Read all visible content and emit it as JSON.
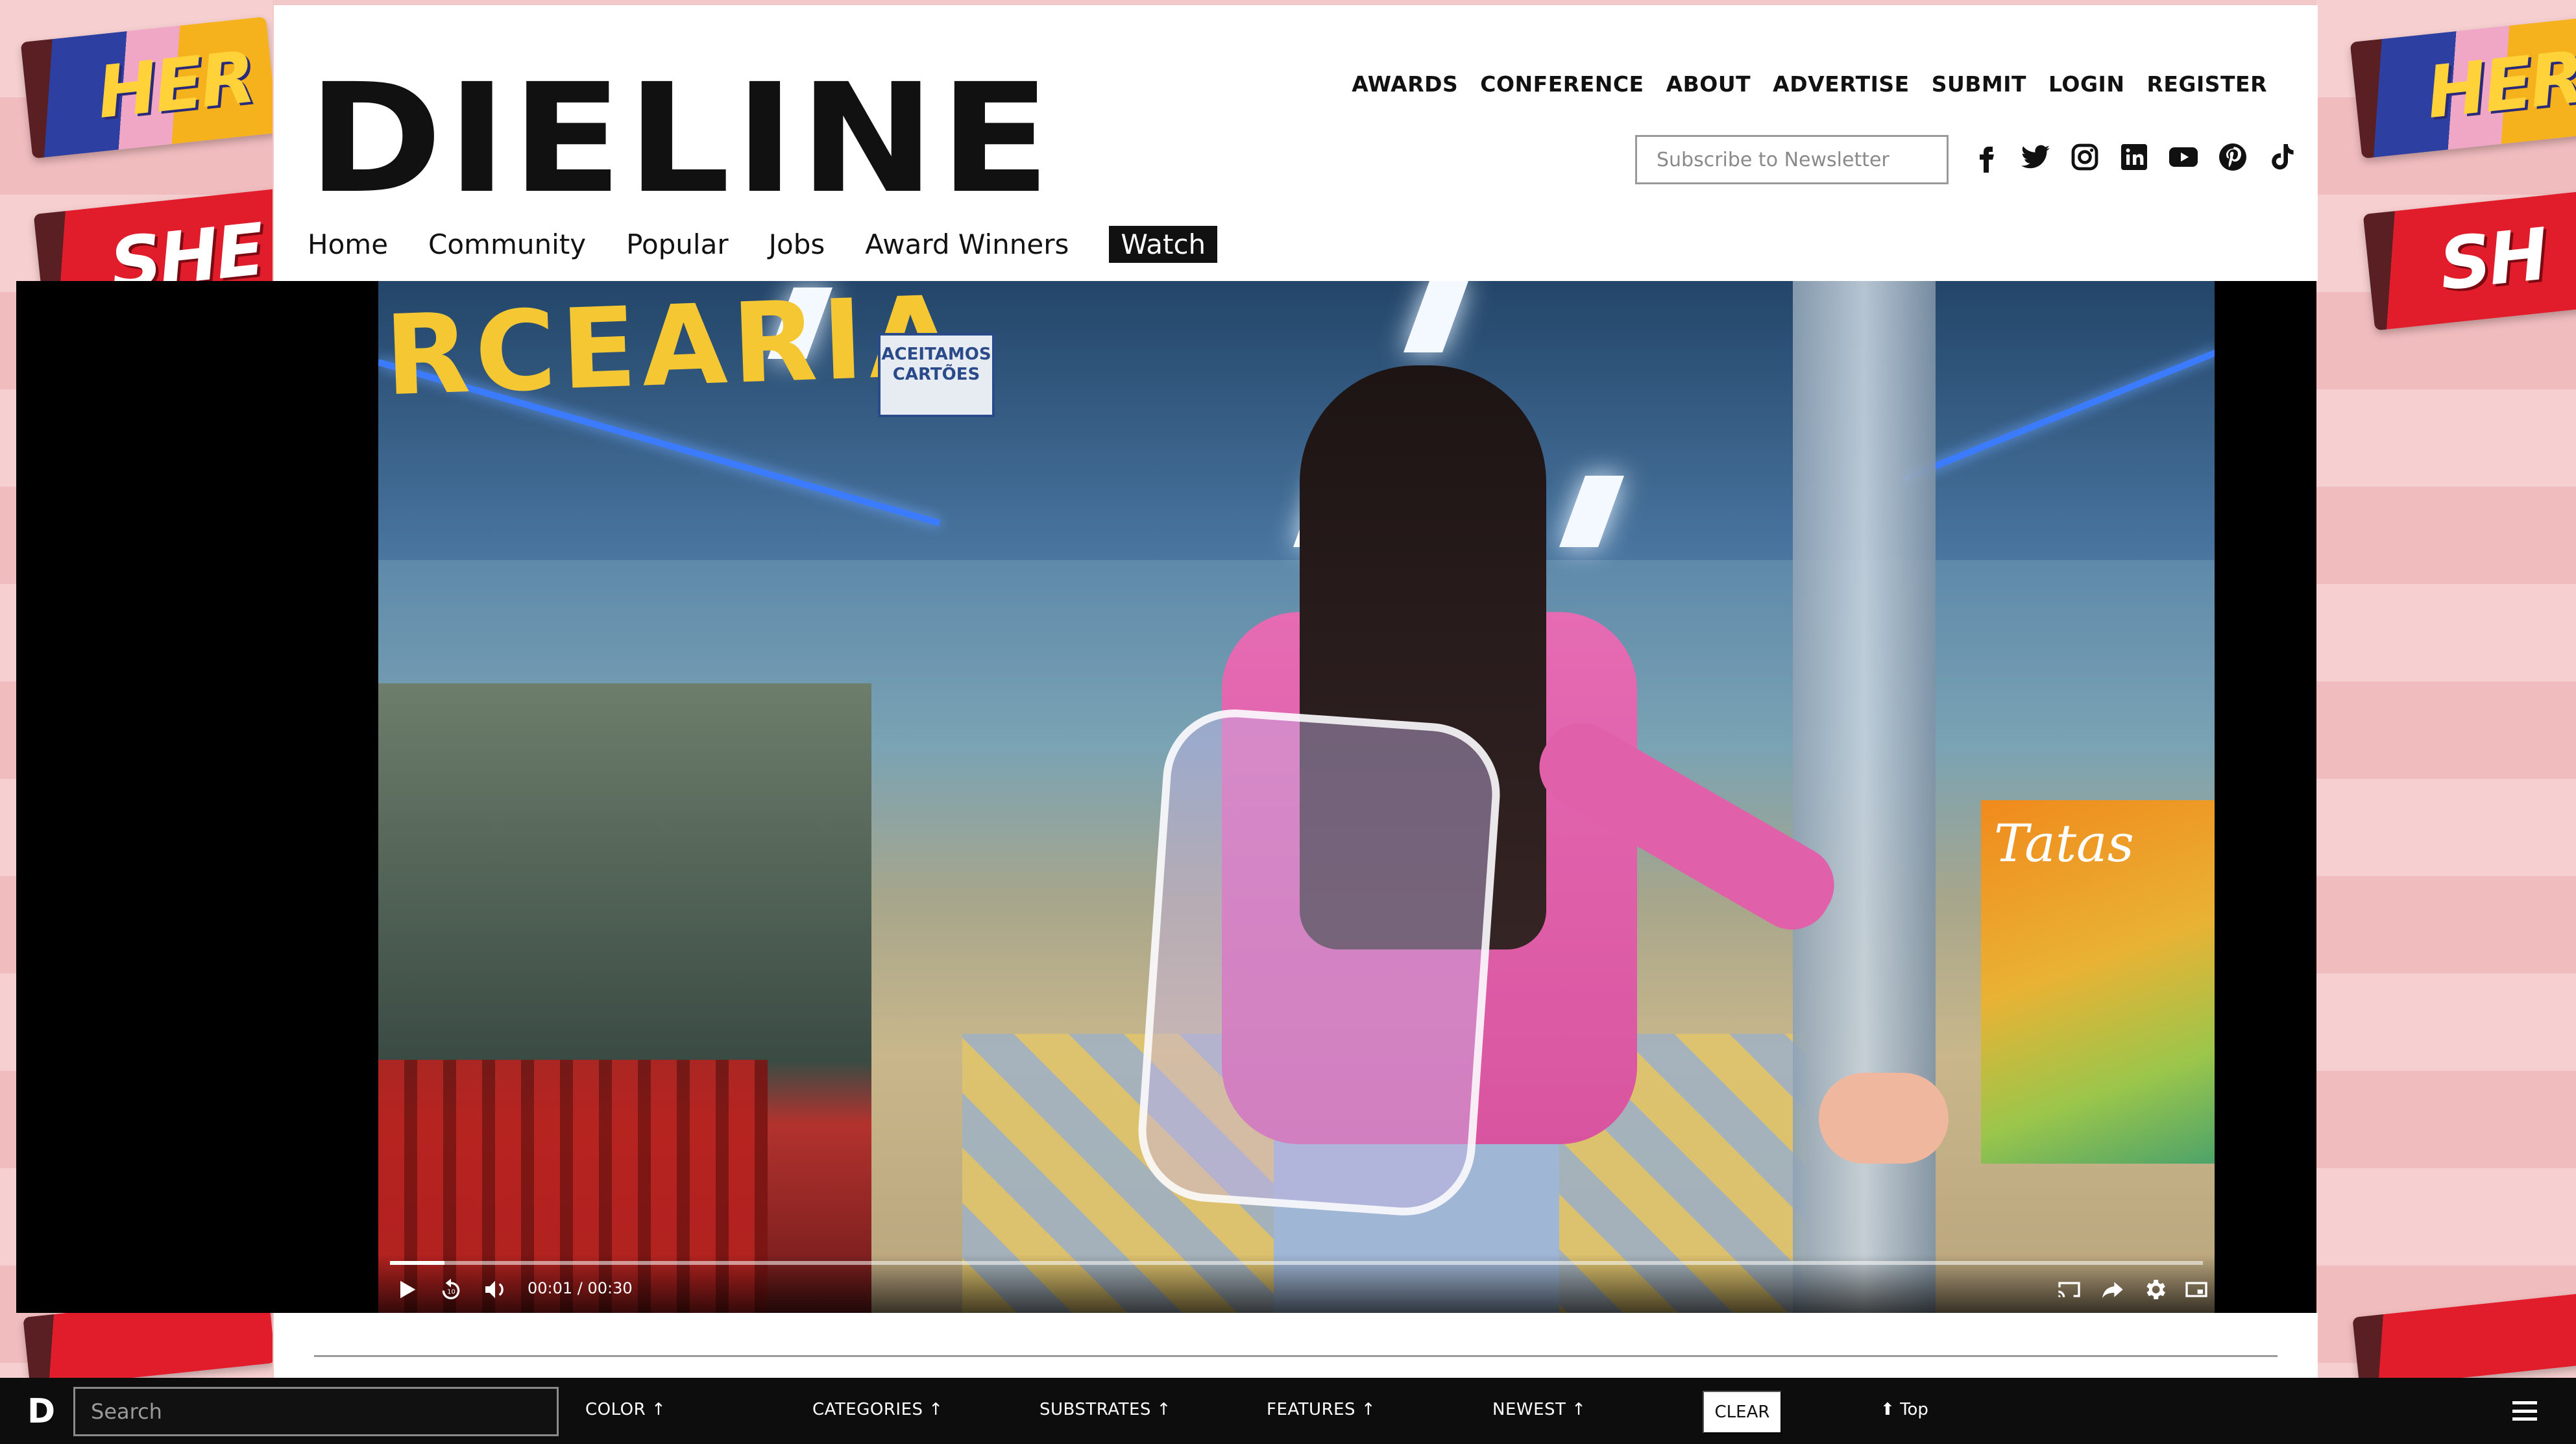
{
  "header": {
    "logo": "DIELINE",
    "top_nav": [
      "AWARDS",
      "CONFERENCE",
      "ABOUT",
      "ADVERTISE",
      "SUBMIT",
      "LOGIN",
      "REGISTER"
    ],
    "newsletter_placeholder": "Subscribe to Newsletter",
    "social_icons": [
      "facebook-icon",
      "twitter-icon",
      "instagram-icon",
      "linkedin-icon",
      "youtube-icon",
      "pinterest-icon",
      "tiktok-icon"
    ],
    "main_nav": [
      "Home",
      "Community",
      "Popular",
      "Jobs",
      "Award Winners",
      "Watch"
    ],
    "active_nav": "Watch"
  },
  "skin": {
    "left_top": "HER",
    "left_second": "SHE",
    "right_top": "HER",
    "right_second": "SH"
  },
  "video": {
    "sign": "RCEARIA",
    "card_sign": "ACEITAMOS CARTÕES",
    "brand_sign": "Tatas",
    "time": "00:01 / 00:30",
    "progress": 0.03
  },
  "filterbar": {
    "logo": "D",
    "search_placeholder": "Search",
    "filters": [
      "COLOR",
      "CATEGORIES",
      "SUBSTRATES",
      "FEATURES",
      "NEWEST"
    ],
    "clear_label": "CLEAR",
    "top_label": "Top"
  },
  "colors": {
    "accent": "#111111",
    "skin_pink": "#f2c8c8",
    "filterbar_bg": "#0d0d0d"
  }
}
